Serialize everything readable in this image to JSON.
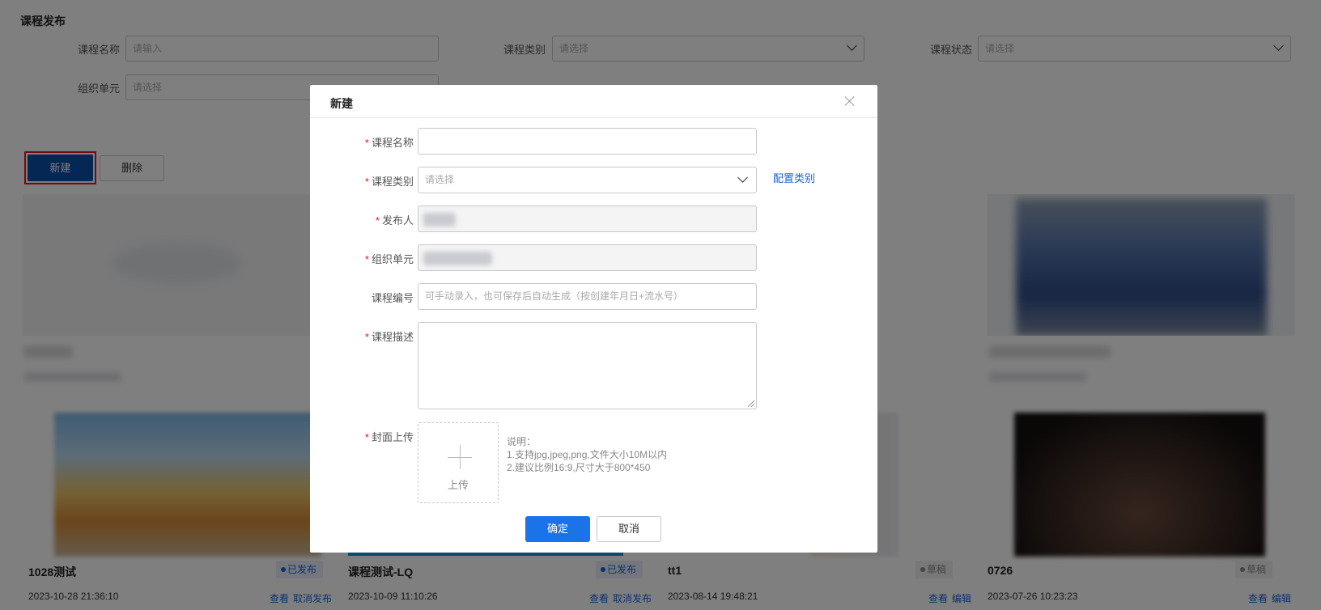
{
  "page": {
    "title": "课程发布",
    "filters": {
      "course_name_label": "课程名称",
      "course_name_placeholder": "请输入",
      "course_type_label": "课程类别",
      "course_type_placeholder": "请选择",
      "course_status_label": "课程状态",
      "course_status_placeholder": "请选择",
      "org_unit_label": "组织单元",
      "org_unit_placeholder": "请选择"
    },
    "toolbar": {
      "new_label": "新建",
      "delete_label": "删除"
    },
    "cards": [
      {
        "title": "1028测试",
        "date": "2023-10-28 21:36:10",
        "status": "已发布",
        "actions": [
          "查看",
          "取消发布"
        ]
      },
      {
        "title": "课程测试-LQ",
        "date": "2023-10-09 11:10:26",
        "status": "已发布",
        "actions": [
          "查看",
          "取消发布"
        ]
      },
      {
        "title": "tt1",
        "date": "2023-08-14 19:48:21",
        "status": "草稿",
        "actions": [
          "查看",
          "编辑"
        ]
      },
      {
        "title": "0726",
        "date": "2023-07-26 10:23:23",
        "status": "草稿",
        "actions": [
          "查看",
          "编辑"
        ]
      }
    ]
  },
  "modal": {
    "title": "新建",
    "fields": {
      "course_name_label": "课程名称",
      "course_type_label": "课程类别",
      "course_type_placeholder": "请选择",
      "config_type_link": "配置类别",
      "publisher_label": "发布人",
      "org_unit_label": "组织单元",
      "course_code_label": "课程编号",
      "course_code_placeholder": "可手动录入，也可保存后自动生成（按创建年月日+流水号）",
      "course_desc_label": "课程描述",
      "cover_label": "封面上传",
      "upload_label": "上传",
      "note_title": "说明：",
      "note_line1": "1.支持jpg,jpeg,png,文件大小10M以内",
      "note_line2": "2.建议比例16:9,尺寸大于800*450"
    },
    "confirm_label": "确定",
    "cancel_label": "取消"
  },
  "colors": {
    "primary": "#1a73e8",
    "highlight": "#e8141c",
    "new_button": "#0a4ea8"
  }
}
